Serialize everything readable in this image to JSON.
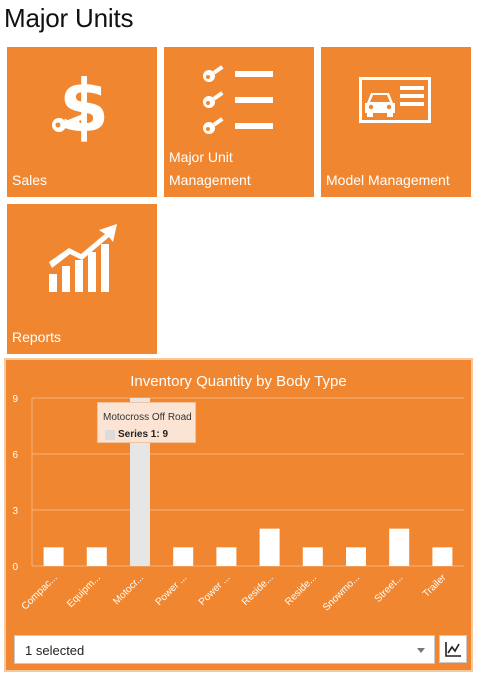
{
  "page": {
    "title": "Major Units"
  },
  "tiles": [
    {
      "label": "Sales",
      "icon": "dollar-key-icon"
    },
    {
      "label": "Major Unit Management",
      "icon": "key-list-icon"
    },
    {
      "label": "Model Management",
      "icon": "car-card-icon"
    },
    {
      "label": "Reports",
      "icon": "growth-chart-icon"
    }
  ],
  "colors": {
    "tile_orange": "#f08730",
    "bar_white": "#ffffff",
    "bar_highlight": "#e6e6e6",
    "tooltip_bg": "#fbe4d3"
  },
  "chart_data": {
    "type": "bar",
    "title": "Inventory Quantity by Body Type",
    "categories": [
      "Compac...",
      "Equipm...",
      "Motocr...",
      "Power ...",
      "Power ...",
      "Reside...",
      "Reside...",
      "Snowmo...",
      "Street...",
      "Trailer"
    ],
    "series": [
      {
        "name": "Series 1",
        "values": [
          1,
          1,
          9,
          1,
          1,
          2,
          1,
          1,
          2,
          1
        ]
      }
    ],
    "ylim": [
      0,
      9
    ],
    "yticks": [
      0,
      3,
      6,
      9
    ],
    "grid": true,
    "highlighted_index": 2,
    "tooltip": {
      "category": "Motocross Off Road",
      "series_text": "Series 1: 9"
    }
  },
  "controls": {
    "series_select_value": "1 selected",
    "chart_type_icon": "line-chart-icon"
  }
}
